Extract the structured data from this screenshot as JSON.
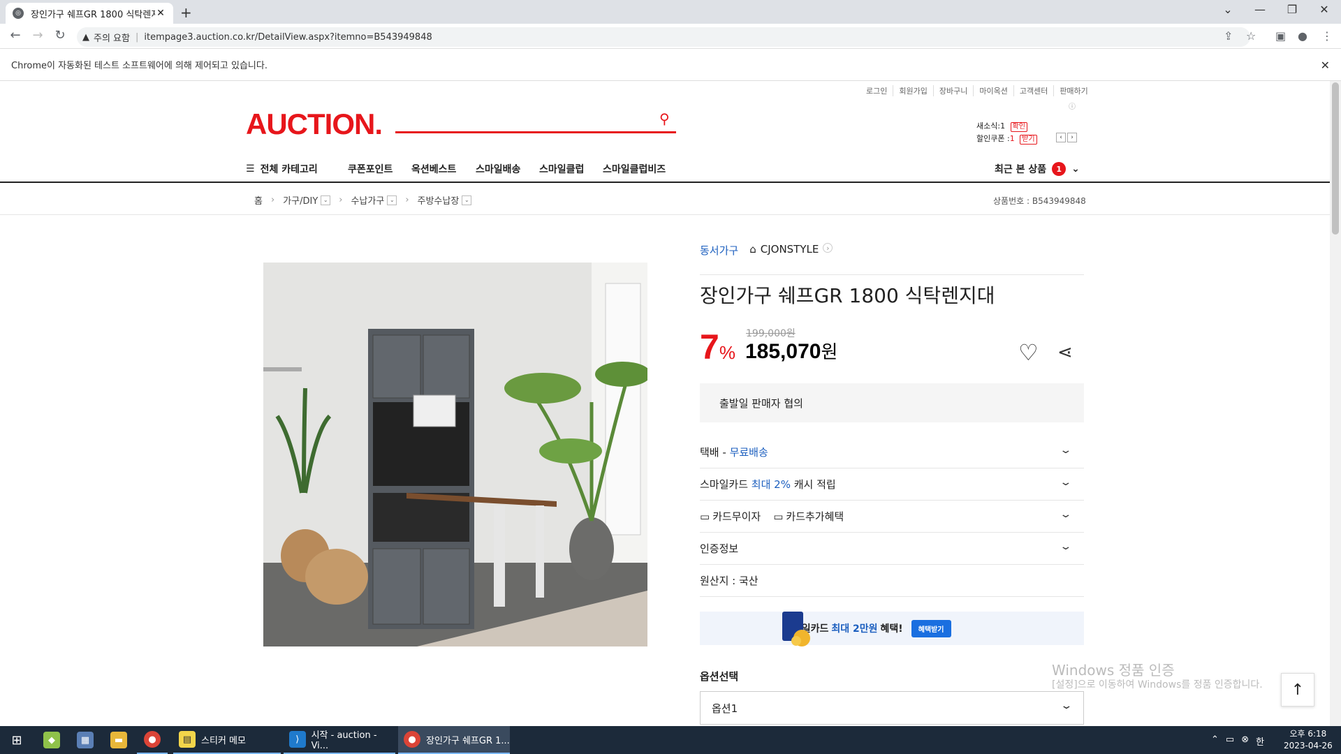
{
  "browser": {
    "tab_title": "장인가구 쉐프GR 1800 식탁렌지",
    "url_warning": "주의 요함",
    "url": "itempage3.auction.co.kr/DetailView.aspx?itemno=B543949848",
    "infobar_text": "Chrome이 자동화된 테스트 소프트웨어에 의해 제어되고 있습니다."
  },
  "header": {
    "util_links": [
      "로그인",
      "회원가입",
      "장바구니",
      "마이옥션",
      "고객센터",
      "판매하기"
    ],
    "logo": "AUCTION.",
    "new_alert_label": "새소식:",
    "new_alert_count": "1",
    "new_alert_btn": "확인",
    "coupon_label": "할인쿠폰 :",
    "coupon_count": "1",
    "coupon_btn": "받기"
  },
  "gnb": {
    "all_category": "전체 카테고리",
    "menus": [
      "쿠폰포인트",
      "옥션베스트",
      "스마일배송",
      "스마일클럽",
      "스마일클럽비즈"
    ],
    "recent": "최근 본 상품",
    "recent_count": "1"
  },
  "breadcrumb": {
    "home": "홈",
    "items": [
      "가구/DIY",
      "수납가구",
      "주방수납장"
    ],
    "item_number": "상품번호 : B543949848"
  },
  "product": {
    "category_link": "동서가구",
    "store": "CJONSTYLE",
    "title": "장인가구 쉐프GR 1800 식탁렌지대",
    "discount": "7",
    "discount_unit": "%",
    "original_price": "199,000원",
    "price": "185,070",
    "price_unit": "원",
    "ship_info": "출발일 판매자 협의",
    "delivery_prefix": "택배 - ",
    "delivery_value": "무료배송",
    "smilecard_prefix": "스마일카드 ",
    "smilecard_highlight": "최대 2%",
    "smilecard_suffix": " 캐시 적립",
    "card_interest": "카드무이자",
    "card_benefit": "카드추가혜택",
    "cert": "인증정보",
    "origin": "원산지 : 국산",
    "banner_prefix": "스마일카드 ",
    "banner_highlight": "최대 2만원",
    "banner_suffix": " 혜택!",
    "banner_btn": "혜택받기",
    "option_label": "옵션선택",
    "option_value": "옵션1"
  },
  "watermark": {
    "line1": "Windows 정품 인증",
    "line2": "[설정]으로 이동하여 Windows를 정품 인증합니다."
  },
  "taskbar": {
    "apps": [
      {
        "label": "스티커 메모"
      },
      {
        "label": "시작 - auction - Vi..."
      },
      {
        "label": "장인가구 쉐프GR 1..."
      }
    ],
    "time": "오후 6:18",
    "date": "2023-04-26"
  }
}
